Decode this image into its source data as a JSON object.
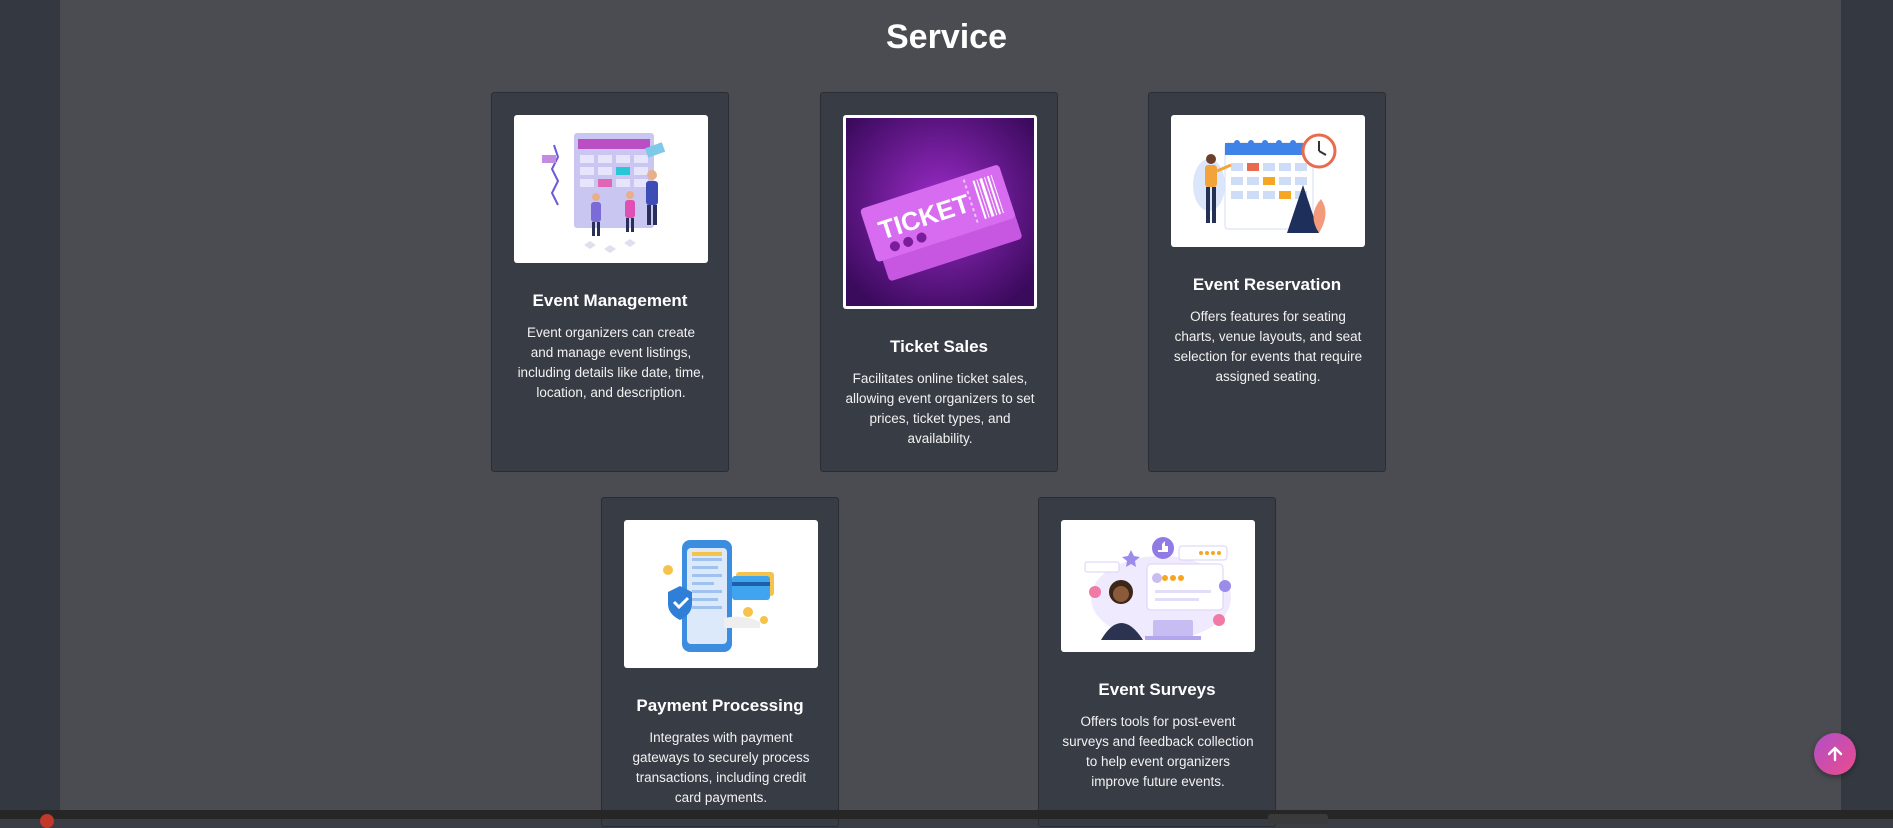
{
  "section": {
    "title": "Service"
  },
  "cards": [
    {
      "title": "Event Management",
      "description": "Event organizers can create and manage event listings, including details like date, time, location, and description.",
      "image_icon": "event-management-illustration-icon"
    },
    {
      "title": "Ticket Sales",
      "description": "Facilitates online ticket sales, allowing event organizers to set prices, ticket types, and availability.",
      "image_icon": "ticket-illustration-icon",
      "ticket_text": "TICKET"
    },
    {
      "title": "Event Reservation",
      "description": "Offers features for seating charts, venue layouts, and seat selection for events that require assigned seating.",
      "image_icon": "calendar-reservation-illustration-icon"
    },
    {
      "title": "Payment Processing",
      "description": "Integrates with payment gateways to securely process transactions, including credit card payments.",
      "image_icon": "phone-payment-illustration-icon"
    },
    {
      "title": "Event Surveys",
      "description": "Offers tools for post-event surveys and feedback collection to help event organizers improve future events.",
      "image_icon": "survey-feedback-illustration-icon"
    }
  ],
  "scroll_top": {
    "icon": "arrow-up-icon"
  },
  "colors": {
    "background": "#4b4c51",
    "card": "#383c45",
    "accent_start": "#b04fc8",
    "accent_end": "#ec4b8c"
  }
}
